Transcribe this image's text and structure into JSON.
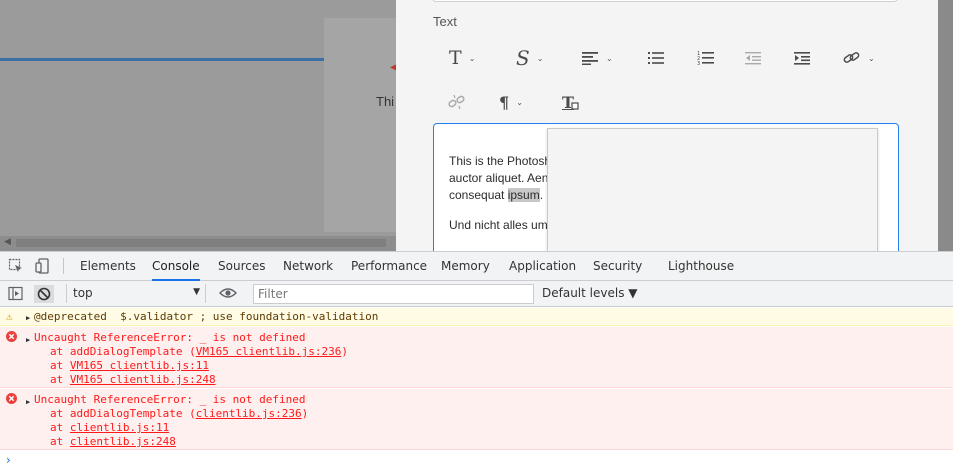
{
  "page": {
    "snippet_text": "Thi"
  },
  "dialog": {
    "field_label": "Text",
    "toolbar_icons": [
      "text-format-icon",
      "strikethrough-style-icon",
      "align-icon",
      "bullet-list-icon",
      "numbered-list-icon",
      "outdent-icon",
      "indent-icon",
      "link-icon",
      "unlink-icon",
      "paragraph-icon",
      "paste-plain-text-icon"
    ],
    "editor": {
      "line1": "This is the Photosh",
      "line2": "auctor aliquet. Aen",
      "line3_before": "consequat ",
      "line3_highlight": "ipsum",
      "line3_after": ".",
      "line4": "Und nicht alles um"
    }
  },
  "devtools": {
    "tabs": [
      "Elements",
      "Console",
      "Sources",
      "Network",
      "Performance",
      "Memory",
      "Application",
      "Security",
      "Lighthouse"
    ],
    "active_tab": "Console",
    "context": "top",
    "filter_placeholder": "Filter",
    "levels": "Default levels ▼",
    "messages": [
      {
        "type": "warning",
        "lines": [
          "@deprecated  $.validator ; use foundation-validation"
        ]
      },
      {
        "type": "error",
        "title": "Uncaught ReferenceError: _ is not defined",
        "frames": [
          {
            "prefix": "at addDialogTemplate (",
            "link": "VM165 clientlib.js:236",
            "suffix": ")"
          },
          {
            "prefix": "at ",
            "link": "VM165 clientlib.js:11",
            "suffix": ""
          },
          {
            "prefix": "at ",
            "link": "VM165 clientlib.js:248",
            "suffix": ""
          }
        ]
      },
      {
        "type": "error",
        "title": "Uncaught ReferenceError: _ is not defined",
        "frames": [
          {
            "prefix": "at addDialogTemplate (",
            "link": "clientlib.js:236",
            "suffix": ")"
          },
          {
            "prefix": "at ",
            "link": "clientlib.js:11",
            "suffix": ""
          },
          {
            "prefix": "at ",
            "link": "clientlib.js:248",
            "suffix": ""
          }
        ]
      }
    ],
    "prompt_symbol": "›"
  },
  "colors": {
    "accent": "#1a73e8",
    "error_text": "#fe1a1a",
    "error_bg": "#fff0f0",
    "warning_bg": "#fffbe5",
    "editor_focus": "#2680eb"
  }
}
